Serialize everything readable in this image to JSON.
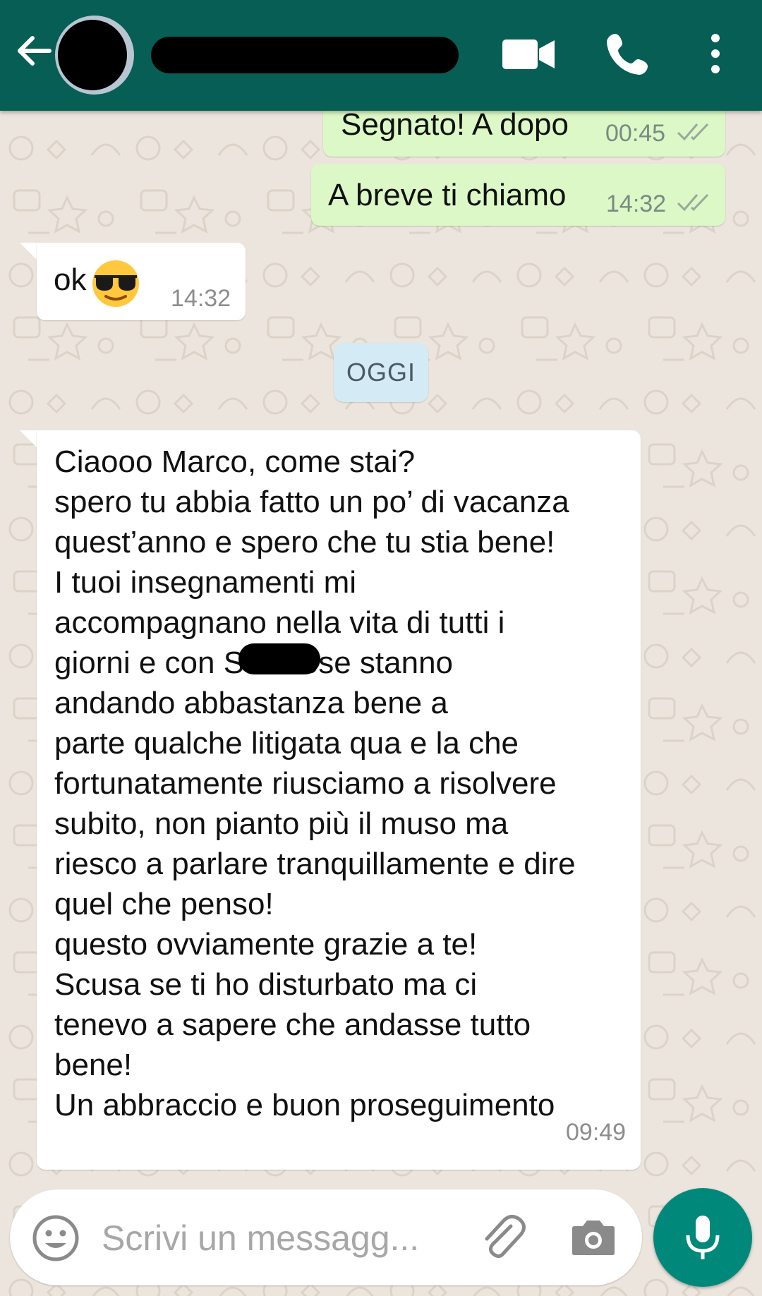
{
  "header": {
    "contact_name": "",
    "icons": [
      "back-arrow-icon",
      "video-call-icon",
      "phone-icon",
      "more-options-icon"
    ],
    "color": "#075E54"
  },
  "messages": [
    {
      "direction": "outgoing",
      "text": "Segnato! A dopo",
      "time": "00:45",
      "status": "read"
    },
    {
      "direction": "outgoing",
      "text": "A breve ti chiamo",
      "time": "14:32",
      "status": "read"
    },
    {
      "direction": "incoming",
      "text": "ok",
      "emoji": "sunglasses",
      "time": "14:32"
    },
    {
      "direction": "incoming",
      "text": "Ciaooo Marco, come stai?\nspero tu abbia fatto un po’ di vacanza\nquest’anno e spero che tu stia bene!\nI tuoi insegnamenti mi\naccompagnano nella vita di tutti i\ngiorni e con S           le cose stanno\nandando abbastanza bene a\nparte qualche litigata qua e la che\nfortunatamente riusciamo a risolvere\nsubito, non pianto più il muso ma\nriesco a parlare tranquillamente e dire\nquel che penso!\nquesto ovviamente grazie a te!\nScusa se ti ho disturbato ma ci\ntenevo a sapere che andasse tutto\nbene!\nUn abbraccio e buon proseguimento",
      "time": "09:49"
    }
  ],
  "date_divider": "OGGI",
  "input": {
    "placeholder": "Scrivi un messagg...",
    "icons": [
      "emoji-icon",
      "attach-icon",
      "camera-icon",
      "mic-icon"
    ]
  },
  "colors": {
    "outgoing_bubble": "#DCF8C6",
    "incoming_bubble": "#FFFFFF",
    "wallpaper": "#ECE5DD",
    "mic_button": "#00897B",
    "date_pill": "#D4EAF4",
    "read_ticks": "#9aa89c"
  }
}
